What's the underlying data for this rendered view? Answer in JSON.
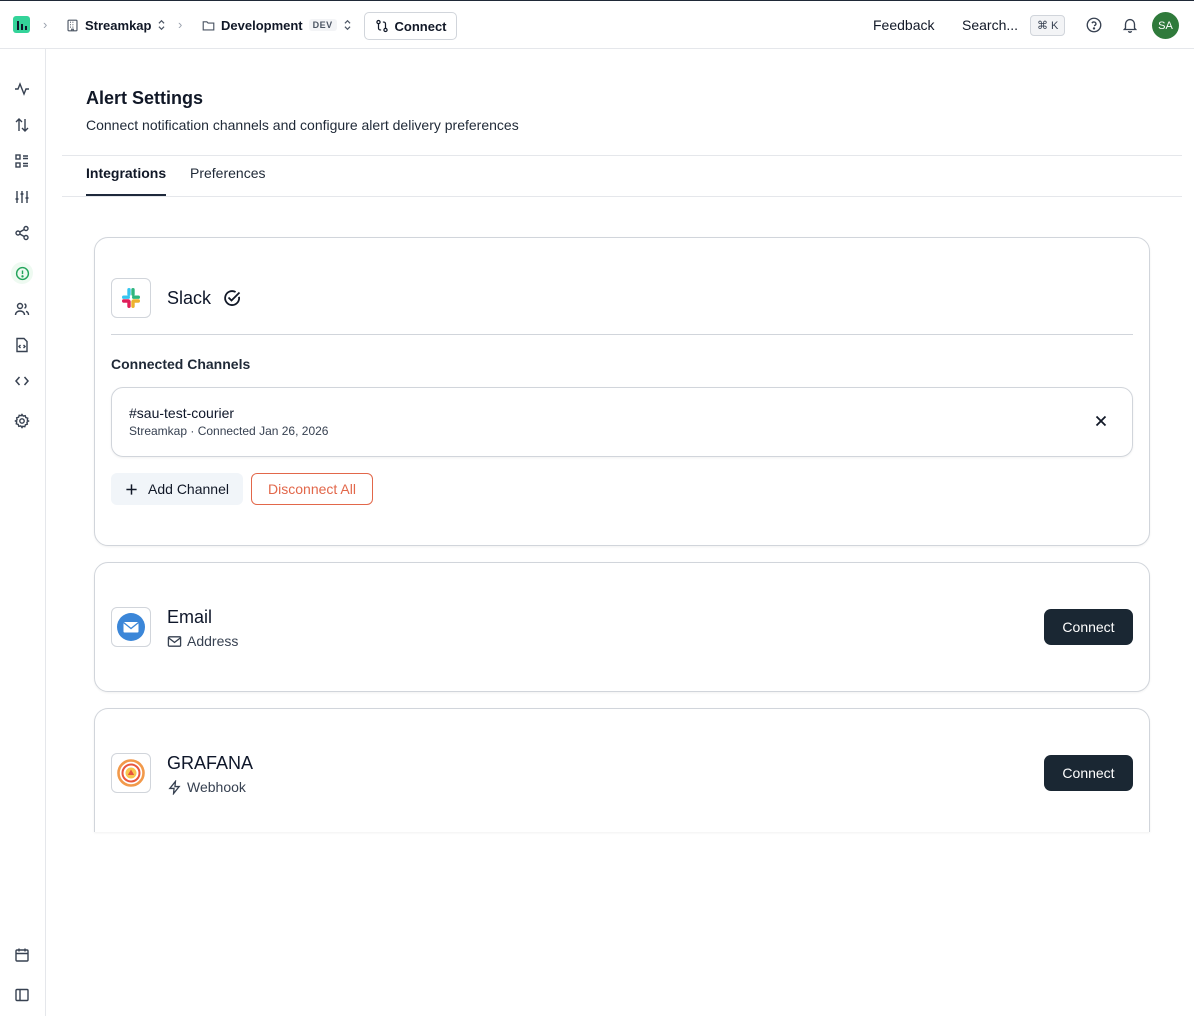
{
  "topbar": {
    "org": "Streamkap",
    "environment": "Development",
    "environment_badge": "DEV",
    "connect_label": "Connect",
    "feedback_label": "Feedback",
    "search_label": "Search...",
    "search_shortcut_symbol": "⌘",
    "search_shortcut_key": "K",
    "avatar_initials": "SA"
  },
  "sidebar": {
    "items": [
      {
        "icon": "activity-icon"
      },
      {
        "icon": "arrows-up-down-icon"
      },
      {
        "icon": "list-grid-icon"
      },
      {
        "icon": "sliders-icon"
      },
      {
        "icon": "share-nodes-icon"
      },
      {
        "icon": "alert-circle-icon",
        "active": true
      },
      {
        "icon": "users-icon"
      },
      {
        "icon": "file-code-icon"
      },
      {
        "icon": "code-icon"
      },
      {
        "icon": "gear-icon"
      },
      {
        "icon": "calendar-icon"
      },
      {
        "icon": "sidebar-toggle-icon"
      }
    ]
  },
  "page": {
    "title": "Alert Settings",
    "subtitle": "Connect notification channels and configure alert delivery preferences"
  },
  "tabs": [
    {
      "label": "Integrations",
      "active": true
    },
    {
      "label": "Preferences",
      "active": false
    }
  ],
  "slack": {
    "name": "Slack",
    "connected_channels_label": "Connected Channels",
    "channels": [
      {
        "name": "#sau-test-courier",
        "meta": "Streamkap · Connected Jan 26, 2026"
      }
    ],
    "add_channel_label": "Add Channel",
    "disconnect_all_label": "Disconnect All"
  },
  "email": {
    "name": "Email",
    "type_label": "Address",
    "connect_label": "Connect"
  },
  "grafana": {
    "name": "GRAFANA",
    "type_label": "Webhook",
    "connect_label": "Connect"
  },
  "colors": {
    "accent_dark": "#1a2733",
    "danger": "#e2674a",
    "active_icon": "#22a35a",
    "avatar_bg": "#2f7a3b"
  }
}
